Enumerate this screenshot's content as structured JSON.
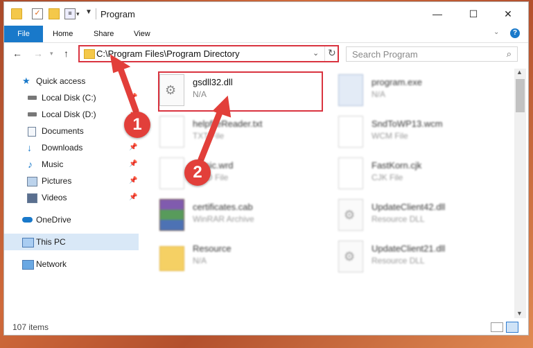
{
  "window": {
    "title": "Program",
    "controls": {
      "minimize": "—",
      "maximize": "☐",
      "close": "✕"
    }
  },
  "ribbon": {
    "tabs": [
      "File",
      "Home",
      "Share",
      "View"
    ]
  },
  "nav": {
    "address": "C:\\Program Files\\Program Directory",
    "search_placeholder": "Search Program"
  },
  "sidebar": {
    "items": [
      {
        "label": "Quick access",
        "icon": "star-icon"
      },
      {
        "label": "Local Disk (C:)",
        "icon": "drive-icon"
      },
      {
        "label": "Local Disk (D:)",
        "icon": "drive-icon"
      },
      {
        "label": "Documents",
        "icon": "documents-icon"
      },
      {
        "label": "Downloads",
        "icon": "downloads-icon"
      },
      {
        "label": "Music",
        "icon": "music-icon"
      },
      {
        "label": "Pictures",
        "icon": "pictures-icon"
      },
      {
        "label": "Videos",
        "icon": "videos-icon"
      },
      {
        "label": "OneDrive",
        "icon": "cloud-icon"
      },
      {
        "label": "This PC",
        "icon": "computer-icon"
      },
      {
        "label": "Network",
        "icon": "network-icon"
      }
    ]
  },
  "files": [
    {
      "name": "gsdll32.dll",
      "type": "N/A",
      "icon": "dll-icon"
    },
    {
      "name": "program.exe",
      "type": "N/A",
      "icon": "exe-icon"
    },
    {
      "name": "helpfileReader.txt",
      "type": "TXT File",
      "icon": "doc-icon"
    },
    {
      "name": "SndToWP13.wcm",
      "type": "WCM File",
      "icon": "doc-icon"
    },
    {
      "name": "Music.wrd",
      "type": "WRD File",
      "icon": "doc-icon"
    },
    {
      "name": "FastKorn.cjk",
      "type": "CJK File",
      "icon": "doc-icon"
    },
    {
      "name": "certificates.cab",
      "type": "WinRAR Archive",
      "icon": "rar-icon"
    },
    {
      "name": "UpdateClient42.dll",
      "type": "Resource DLL",
      "icon": "dll-icon"
    },
    {
      "name": "Resource",
      "type": "N/A",
      "icon": "folder-icon"
    },
    {
      "name": "UpdateClient21.dll",
      "type": "Resource DLL",
      "icon": "dll-icon"
    }
  ],
  "status": {
    "count": "107 items"
  },
  "annotations": {
    "step1": "1",
    "step2": "2",
    "color": "#e23f3a"
  }
}
